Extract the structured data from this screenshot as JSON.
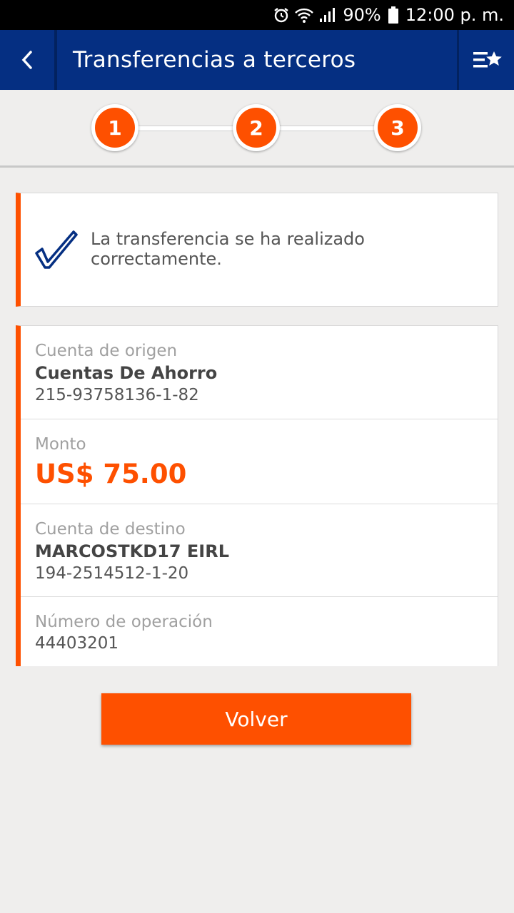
{
  "status_bar": {
    "battery": "90%",
    "time": "12:00 p. m."
  },
  "header": {
    "title": "Transferencias a terceros",
    "back_icon": "chevron-left-icon",
    "favorites_icon": "list-star-icon"
  },
  "stepper": {
    "steps": [
      "1",
      "2",
      "3"
    ],
    "current": 3
  },
  "success": {
    "message": "La transferencia se ha realizado correctamente.",
    "icon": "check-icon"
  },
  "details": {
    "origin": {
      "label": "Cuenta de origen",
      "name": "Cuentas De Ahorro",
      "number": "215-93758136-1-82"
    },
    "amount": {
      "label": "Monto",
      "value": "US$ 75.00"
    },
    "destination": {
      "label": "Cuenta de destino",
      "name": "MARCOSTKD17 EIRL",
      "number": "194-2514512-1-20"
    },
    "operation": {
      "label": "Número de operación",
      "number": "44403201"
    }
  },
  "actions": {
    "back_label": "Volver"
  },
  "colors": {
    "primary": "#052f82",
    "accent": "#fe5000",
    "background": "#efeeed"
  }
}
